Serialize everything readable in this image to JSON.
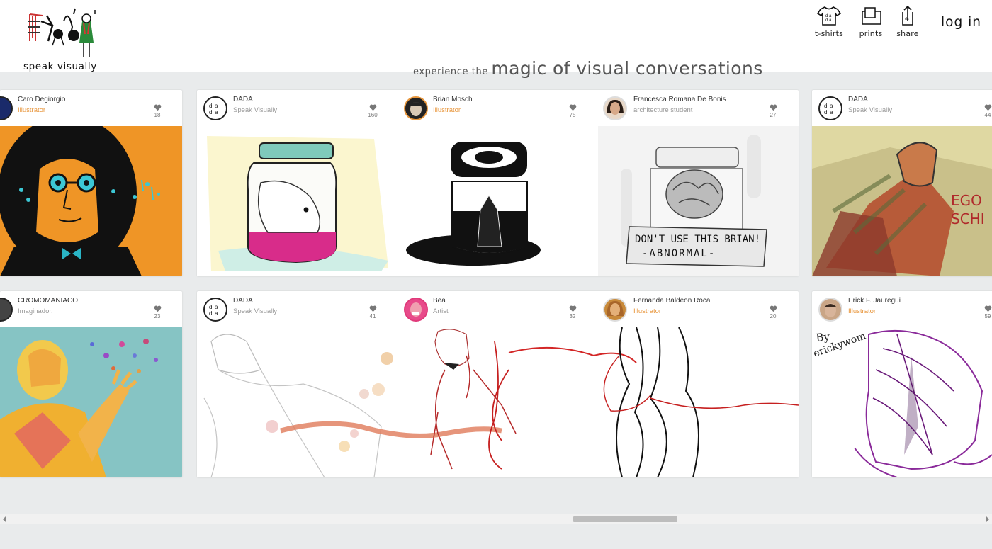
{
  "brand": {
    "name": "speak visually"
  },
  "nav": {
    "tshirts": "t-shirts",
    "prints": "prints",
    "share": "share",
    "login": "log in"
  },
  "tagline": {
    "small": "experience the",
    "big": "magic of visual conversations"
  },
  "colors": {
    "accent_orange": "#e8963c",
    "background": "#e9ebec",
    "header_bg": "#ffffff"
  },
  "row1": {
    "left": {
      "name": "Caro Degiorgio",
      "role": "Illustrator",
      "likes": "18"
    },
    "middle": [
      {
        "name": "DADA",
        "role": "Speak Visually",
        "likes": "160"
      },
      {
        "name": "Brian Mosch",
        "role": "Illustrator",
        "likes": "75"
      },
      {
        "name": "Francesca Romana De Bonis",
        "role": "architecture student",
        "likes": "27"
      }
    ],
    "right": {
      "name": "DADA",
      "role": "Speak Visually",
      "likes": "44"
    }
  },
  "row2": {
    "left": {
      "name": "CROMOMANIACO",
      "role": "Imaginador.",
      "likes": "23"
    },
    "middle": [
      {
        "name": "DADA",
        "role": "Speak Visually",
        "likes": "41"
      },
      {
        "name": "Bea",
        "role": "Artist",
        "likes": "32"
      },
      {
        "name": "Fernanda Baldeon Roca",
        "role": "Illustrator",
        "likes": "20"
      }
    ],
    "right": {
      "name": "Erick F. Jauregui",
      "role": "Illustrator",
      "likes": "59"
    }
  },
  "art_text": {
    "brain_sign_line1": "DON'T USE THIS BRIAN!",
    "brain_sign_line2": "-ABNORMAL-",
    "egon_text_1": "EGO",
    "egon_text_2": "SCHI",
    "signature_1": "By",
    "signature_2": "erickywom"
  },
  "icons": [
    "tshirt-icon",
    "prints-icon",
    "share-icon",
    "heart-icon",
    "logo-icon"
  ]
}
